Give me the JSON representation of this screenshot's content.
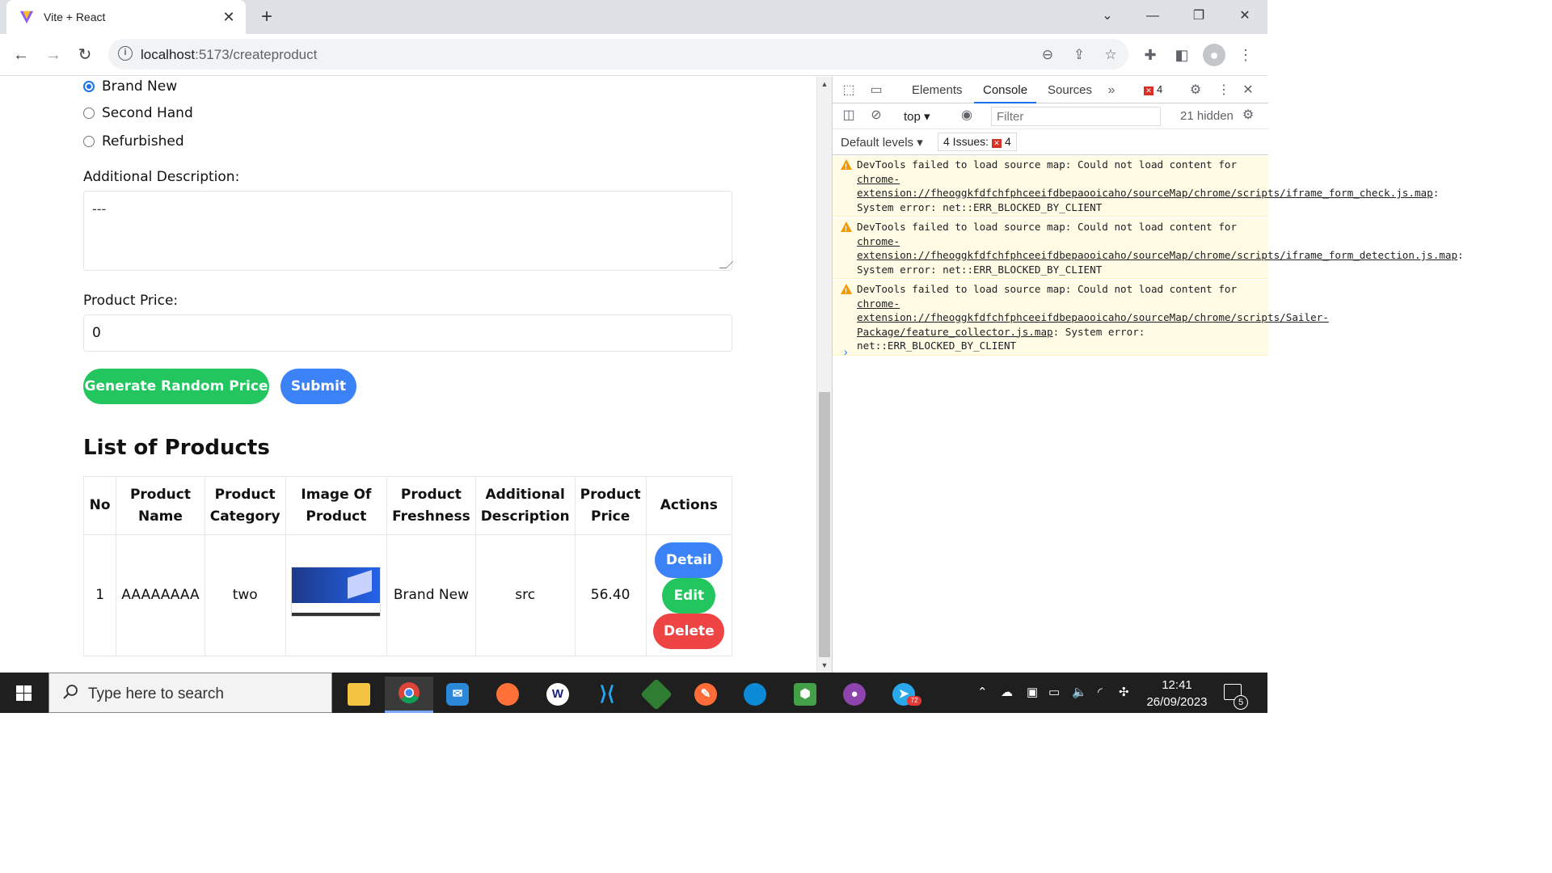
{
  "browser": {
    "tab_title": "Vite + React",
    "tab_close": "✕",
    "new_tab": "+",
    "url_host": "localhost",
    "url_path": ":5173/createproduct"
  },
  "form": {
    "freshness_options": [
      {
        "label": "Brand New",
        "checked": true
      },
      {
        "label": "Second Hand",
        "checked": false
      },
      {
        "label": "Refurbished",
        "checked": false
      }
    ],
    "description_label": "Additional Description:",
    "description_value": "---",
    "price_label": "Product Price:",
    "price_value": "0",
    "random_price_button": "Generate Random Price",
    "submit_button": "Submit"
  },
  "products": {
    "title": "List of Products",
    "headers": [
      "No",
      "Product Name",
      "Product Category",
      "Image Of Product",
      "Product Freshness",
      "Additional Description",
      "Product Price",
      "Actions"
    ],
    "rows": [
      {
        "no": "1",
        "name": "AAAAAAAA",
        "category": "two",
        "freshness": "Brand New",
        "description": "src",
        "price": "56.40"
      }
    ],
    "actions": {
      "detail": "Detail",
      "edit": "Edit",
      "delete": "Delete"
    }
  },
  "devtools": {
    "tabs": [
      "Elements",
      "Console",
      "Sources"
    ],
    "active_tab": "Console",
    "error_count": "4",
    "context": "top",
    "filter_placeholder": "Filter",
    "hidden": "21 hidden",
    "levels": "Default levels",
    "issues_label": "4 Issues:",
    "issues_count": "4",
    "messages": [
      {
        "prefix": "DevTools failed to load source map: Could not load content for ",
        "link": "chrome-extension://fheoggkfdfchfphceeifdbepaooicaho/sourceMap/chrome/scripts/iframe_form_check.js.map",
        "suffix": ": System error: net::ERR_BLOCKED_BY_CLIENT"
      },
      {
        "prefix": "DevTools failed to load source map: Could not load content for ",
        "link": "chrome-extension://fheoggkfdfchfphceeifdbepaooicaho/sourceMap/chrome/scripts/iframe_form_detection.js.map",
        "suffix": ": System error: net::ERR_BLOCKED_BY_CLIENT"
      },
      {
        "prefix": "DevTools failed to load source map: Could not load content for ",
        "link": "chrome-extension://fheoggkfdfchfphceeifdbepaooicaho/sourceMap/chrome/scripts/Sailer-Package/feature_collector.js.map",
        "suffix": ": System error: net::ERR_BLOCKED_BY_CLIENT"
      }
    ],
    "prompt": "›"
  },
  "taskbar": {
    "search_placeholder": "Type here to search",
    "time": "12:41",
    "date": "26/09/2023",
    "notification_count": "5",
    "telegram_badge": "72"
  }
}
